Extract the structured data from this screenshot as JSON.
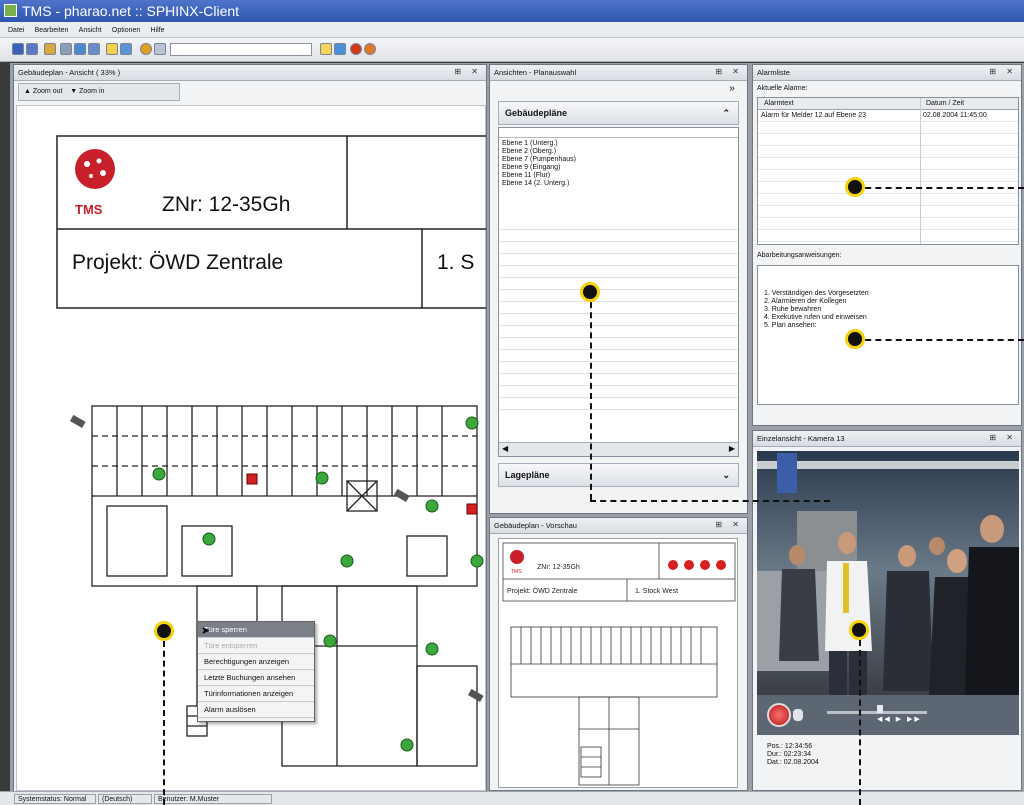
{
  "app": {
    "title": "TMS - pharao.net :: SPHINX-Client"
  },
  "menu": {
    "items": [
      "Datei",
      "Bearbeiten",
      "Ansicht",
      "Optionen",
      "Hilfe"
    ]
  },
  "plan": {
    "title": "Gebäudeplan - Ansicht ( 33% )",
    "zoom_out": "Zoom out",
    "zoom_in": "Zoom in",
    "logo": "TMS",
    "znr": "ZNr: 12-35Gh",
    "projekt": "Projekt: ÖWD Zentrale",
    "floor_partial": "1. S"
  },
  "context_menu": {
    "items": [
      "Türe sperren",
      "Türe entsperren",
      "Berechtigungen anzeigen",
      "Letzte Buchungen ansehen",
      "Türinformationen anzeigen",
      "Alarm auslösen"
    ],
    "disabled": [
      false,
      true,
      false,
      false,
      false,
      false
    ],
    "highlighted": [
      true,
      false,
      false,
      false,
      false,
      false
    ]
  },
  "views": {
    "title": "Ansichten - Planauswahl",
    "group1": "Gebäudepläne",
    "floors": [
      "Ebene 1 (Unterg.)",
      "Ebene 2 (Oberg.)",
      "Ebene 7 (Pumpenhaus)",
      "Ebene 9 (Eingang)",
      "Ebene 11 (Flur)",
      "Ebene 14 (2. Unterg.)"
    ],
    "group2": "Lagepläne"
  },
  "preview": {
    "title": "Gebäudeplan - Vorschau",
    "logo": "TMS",
    "znr": "ZNr: 12-35Gh",
    "projekt": "Projekt: ÖWD Zentrale",
    "floor": "1. Stock West"
  },
  "alarms": {
    "title": "Alarmliste",
    "current_label": "Aktuelle Alarme:",
    "col_text": "Alarmtext",
    "col_date": "Datum / Zeit",
    "rows": [
      {
        "text": "Alarm für Melder 12 auf Ebene 23",
        "date": "02.08.2004    11:45:00"
      }
    ],
    "instructions_label": "Abarbeitungsanweisungen:",
    "steps": [
      "1.   Verständigen des Vorgesetzten",
      "2.   Alarmieren der Kollegen",
      "3.   Ruhe bewahren",
      "4.   Exekutive rufen und einweisen",
      "5.   Plan ansehen:"
    ]
  },
  "camera": {
    "title": "Einzelansicht - Kamera 13",
    "pos": "Pos.: 12:34:56",
    "dur": "Dur.:  02:23:34",
    "dat": "Dat.:  02.08.2004"
  },
  "status": {
    "system": "Systemstatus: Normal",
    "lang": "(Deutsch)",
    "user": "Benutzer: M.Muster"
  },
  "colors": {
    "accent": "#f5d20a",
    "titlebar": "#3a62bf",
    "alarm_red": "#d42020",
    "sensor_green": "#3aa83a"
  }
}
